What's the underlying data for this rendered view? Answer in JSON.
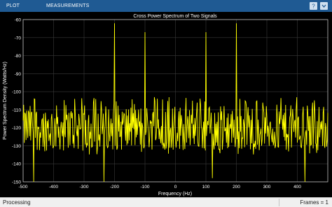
{
  "toolbar": {
    "tabs": [
      "PLOT",
      "MEASUREMENTS"
    ],
    "icons": [
      "help-icon",
      "expand-icon"
    ],
    "background": "#1f5a93"
  },
  "status": {
    "state": "Processing",
    "frames": "Frames = 1"
  },
  "chart_data": {
    "type": "line",
    "title": "Cross Power Spectrum of Two Signals",
    "xlabel": "Frequency (Hz)",
    "ylabel": "Power Spectrum Density (Watts/Hz)",
    "xlim": [
      -500,
      500
    ],
    "ylim": [
      -150,
      -60
    ],
    "xticks": [
      -500,
      -400,
      -300,
      -200,
      -100,
      0,
      100,
      200,
      300,
      400
    ],
    "yticks": [
      -60,
      -70,
      -80,
      -90,
      -100,
      -110,
      -120,
      -130,
      -140,
      -150
    ],
    "grid": true,
    "background": "#000000",
    "axes_color": "#c0c0c0",
    "line_color": "#ffff00",
    "noise_floor_mean": -120,
    "noise_floor_range": [
      -135,
      -103
    ],
    "peaks": [
      {
        "x": -200,
        "y": -62
      },
      {
        "x": -100,
        "y": -67
      },
      {
        "x": 100,
        "y": -67
      },
      {
        "x": 200,
        "y": -62
      }
    ],
    "dips": [
      {
        "x": -465,
        "y": -150
      },
      {
        "x": -235,
        "y": -150
      },
      {
        "x": 122,
        "y": -148
      },
      {
        "x": 425,
        "y": -150
      }
    ]
  }
}
